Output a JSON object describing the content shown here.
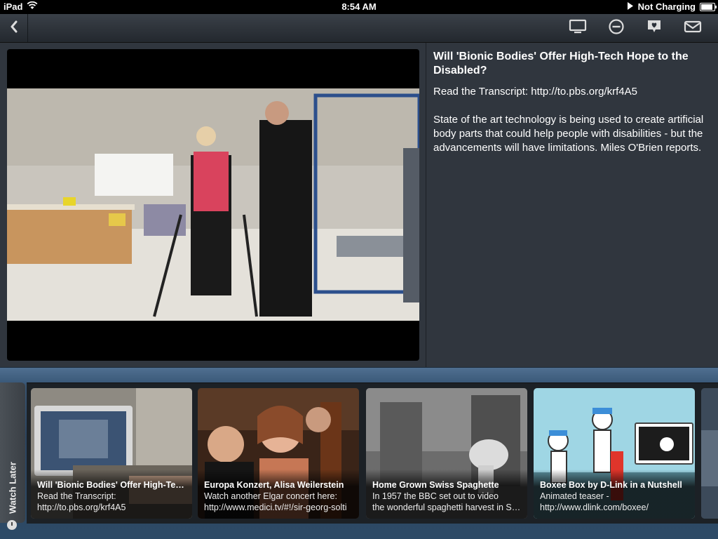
{
  "status_bar": {
    "device": "iPad",
    "time": "8:54 AM",
    "charging": "Not Charging",
    "battery_level": 0.9
  },
  "toolbar": {
    "icons": [
      "chevron-left-icon",
      "tv-icon",
      "minus-circle-icon",
      "heart-bubble-icon",
      "mail-icon"
    ]
  },
  "video": {
    "title": "Will 'Bionic Bodies' Offer High-Tech Hope to the Disabled?",
    "transcript": "Read the Transcript:  http://to.pbs.org/krf4A5",
    "description": "State of the art technology is being used to create artificial body parts that could help people with disabilities - but the advancements will have limitations. Miles O'Brien reports."
  },
  "watch_later": {
    "tab_label": "Watch Later",
    "items": [
      {
        "title": "Will 'Bionic Bodies' Offer High-Tech Hope to the Disabled?",
        "line1": "Read the Transcript:",
        "line2": "http://to.pbs.org/krf4A5"
      },
      {
        "title": "Europa Konzert, Alisa Weilerstein",
        "line1": "Watch another Elgar concert here:",
        "line2": "http://www.medici.tv/#!/sir-georg-solti"
      },
      {
        "title": "Home Grown Swiss Spaghette",
        "line1": "In 1957 the BBC set out to video",
        "line2": "the wonderful spaghetti harvest in Switzerland"
      },
      {
        "title": "Boxee Box by D-Link in a Nutshell",
        "line1": "Animated teaser -",
        "line2": "http://www.dlink.com/boxee/"
      }
    ]
  }
}
